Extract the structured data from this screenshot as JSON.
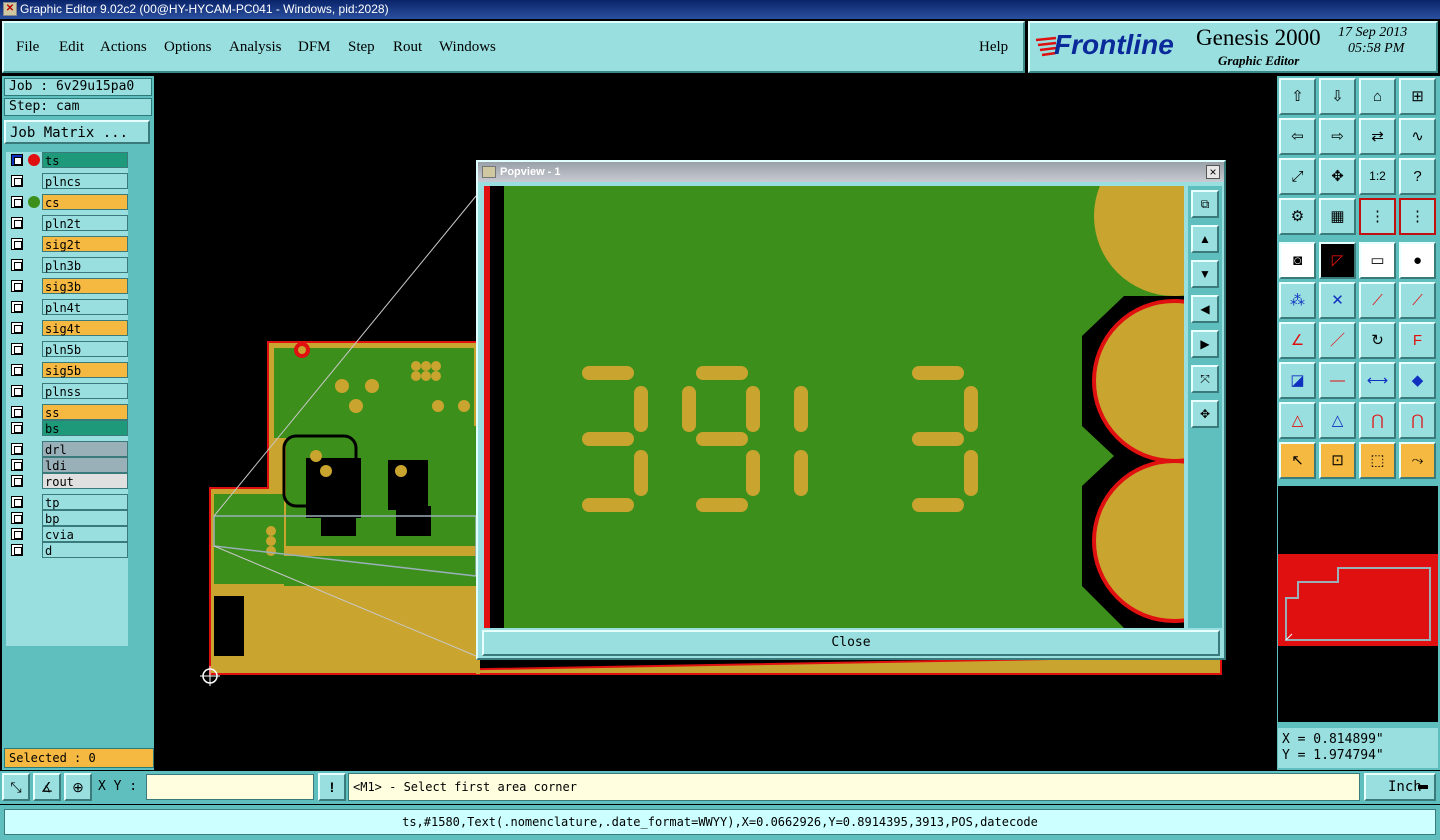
{
  "window": {
    "title": "Graphic Editor 9.02c2 (00@HY-HYCAM-PC041 - Windows, pid:2028)"
  },
  "menu": {
    "file": "File",
    "edit": "Edit",
    "actions": "Actions",
    "options": "Options",
    "analysis": "Analysis",
    "dfm": "DFM",
    "step": "Step",
    "rout": "Rout",
    "windows": "Windows",
    "help": "Help"
  },
  "brand": {
    "logo": "Frontline",
    "product": "Genesis 2000",
    "subtitle": "Graphic Editor",
    "date": "17 Sep 2013",
    "time": "05:58 PM"
  },
  "job": {
    "job_label": "Job : 6v29u15pa0",
    "step_label": "Step: cam",
    "matrix_button": "Job Matrix ..."
  },
  "layers": [
    {
      "name": "ts",
      "color": "#1e9a7a",
      "dot": "#e01010",
      "selected": true
    },
    {
      "name": "plncs",
      "color": "#99dfdf"
    },
    {
      "name": "cs",
      "color": "#f5b942",
      "dot": "#3d8f1c"
    },
    {
      "name": "pln2t",
      "color": "#99dfdf"
    },
    {
      "name": "sig2t",
      "color": "#f5b942"
    },
    {
      "name": "pln3b",
      "color": "#99dfdf"
    },
    {
      "name": "sig3b",
      "color": "#f5b942"
    },
    {
      "name": "pln4t",
      "color": "#99dfdf"
    },
    {
      "name": "sig4t",
      "color": "#f5b942"
    },
    {
      "name": "pln5b",
      "color": "#99dfdf"
    },
    {
      "name": "sig5b",
      "color": "#f5b942"
    },
    {
      "name": "plnss",
      "color": "#99dfdf"
    },
    {
      "name": "ss",
      "color": "#f5b942"
    },
    {
      "name": "bs",
      "color": "#1e9a7a"
    },
    {
      "name": "drl",
      "color": "#9ab0b8"
    },
    {
      "name": "ldi",
      "color": "#9ab0b8"
    },
    {
      "name": "rout",
      "color": "#e0e0e0"
    },
    {
      "name": "tp",
      "color": "#99dfdf"
    },
    {
      "name": "bp",
      "color": "#99dfdf"
    },
    {
      "name": "cvia",
      "color": "#99dfdf"
    },
    {
      "name": "d",
      "color": "#99dfdf"
    }
  ],
  "selected": "Selected : 0",
  "popup": {
    "title": "Popview - 1",
    "close_label": "Close",
    "close_x": "×"
  },
  "coords": {
    "x": "X = 0.814899\"",
    "y": "Y = 1.974794\""
  },
  "bottom": {
    "xy_label": "X Y :",
    "xy_value": "",
    "prompt": "<M1> - Select first area corner",
    "units": "Inch"
  },
  "status": "ts,#1580,Text(.nomenclature,.date_format=WWYY),X=0.0662926,Y=0.8914395,3913,POS,datecode",
  "colors": {
    "panel": "#99dfdf",
    "board": "#c9a42e",
    "copper_green": "#3d8f1c",
    "outline": "#e01010"
  }
}
